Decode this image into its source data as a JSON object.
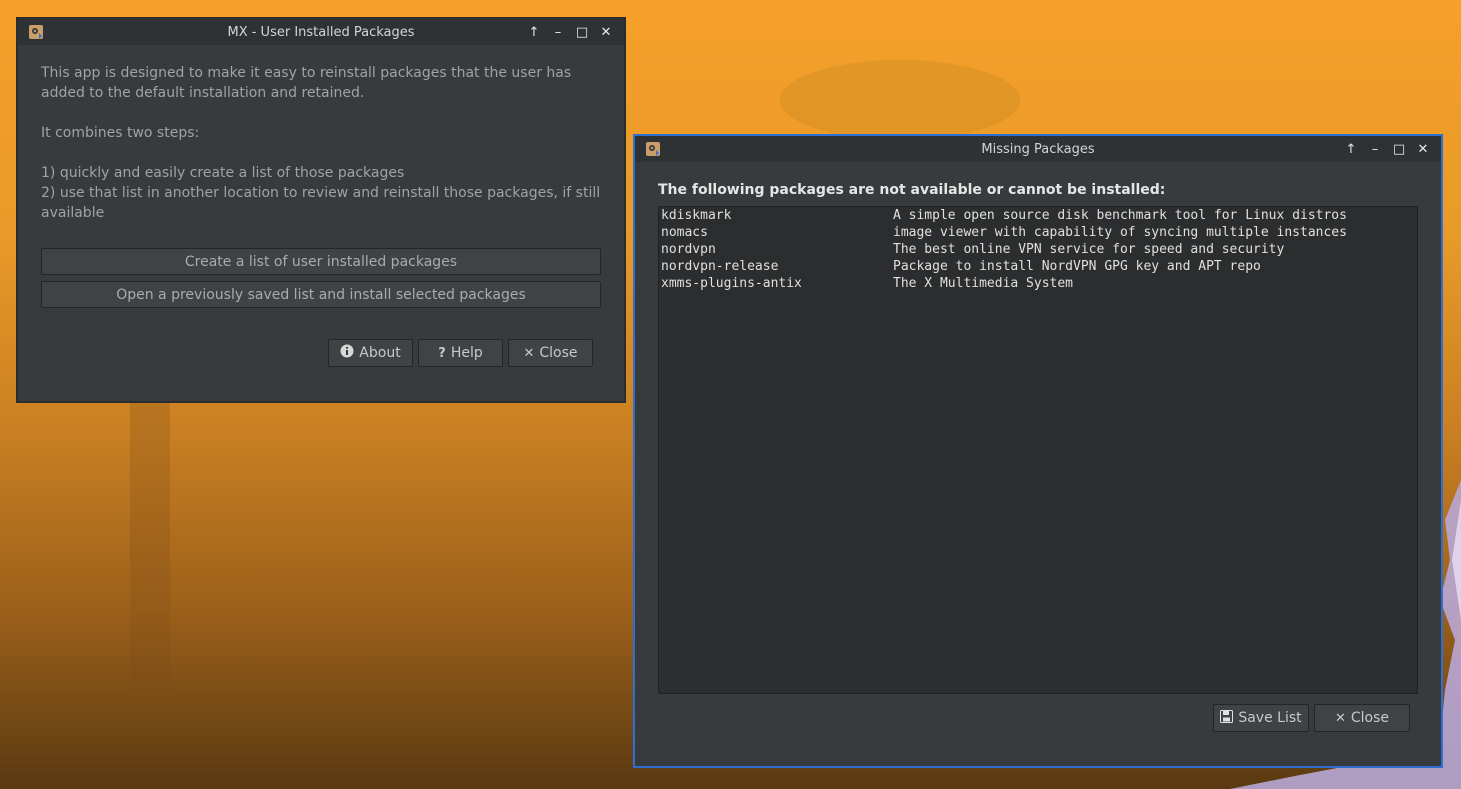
{
  "main_window": {
    "title": "MX - User Installed Packages",
    "description": [
      "This app is designed to make it easy to reinstall packages that the user has added to the default installation and retained.",
      "It combines two steps:",
      "1) quickly and easily create a list of those packages",
      "2) use that list in another location to review and reinstall those packages, if still available"
    ],
    "create_button": "Create a list of user installed packages",
    "open_button": "Open a previously saved list and install selected packages",
    "about_button": "About",
    "help_button": "Help",
    "close_button": "Close"
  },
  "missing_window": {
    "title": "Missing Packages",
    "heading": "The following packages are not available or cannot be installed:",
    "packages": [
      {
        "name": "kdiskmark",
        "description": "A simple open source disk benchmark tool for Linux distros"
      },
      {
        "name": "nomacs",
        "description": "image viewer with capability of syncing multiple instances"
      },
      {
        "name": "nordvpn",
        "description": "The best online VPN service for speed and security"
      },
      {
        "name": "nordvpn-release",
        "description": "Package to install NordVPN GPG key and APT repo"
      },
      {
        "name": "xmms-plugins-antix",
        "description": "The X Multimedia System"
      }
    ],
    "save_button": "Save List",
    "close_button": "Close"
  },
  "icons": {
    "app": "package-app-icon",
    "maximize_up": "arrow-up-icon",
    "minimize": "minimize-icon",
    "maximize": "maximize-icon",
    "close": "close-icon",
    "about": "info-icon",
    "help": "question-icon",
    "save": "floppy-disk-icon"
  },
  "colors": {
    "window_bg": "#373b3d",
    "titlebar_bg": "#2f3234",
    "active_border": "#2e6fd3",
    "listbox_bg": "#2b2d2e"
  }
}
